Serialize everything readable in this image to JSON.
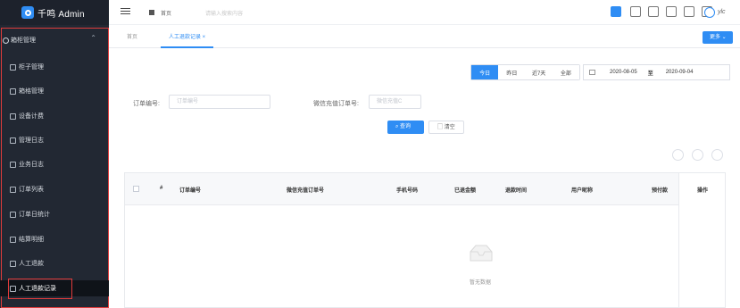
{
  "app": {
    "title": "千鸣 Admin"
  },
  "sidebar": {
    "group": {
      "label": "箱柜管理",
      "icon": "gear-icon"
    },
    "items": [
      {
        "label": "柜子管理",
        "icon": "monitor-icon"
      },
      {
        "label": "箱格管理",
        "icon": "grid-icon"
      },
      {
        "label": "设备计费",
        "icon": "document-icon"
      },
      {
        "label": "管理日志",
        "icon": "document-icon"
      },
      {
        "label": "业务日志",
        "icon": "document-icon"
      },
      {
        "label": "订单列表",
        "icon": "list-icon"
      },
      {
        "label": "订单日统计",
        "icon": "chart-icon"
      },
      {
        "label": "结算明细",
        "icon": "list-icon"
      },
      {
        "label": "人工退款",
        "icon": "image-icon"
      },
      {
        "label": "人工退款记录",
        "icon": "user-icon",
        "active": true
      }
    ]
  },
  "header": {
    "breadcrumb": "首页",
    "search_placeholder": "请输入搜索内容",
    "username": "ylc"
  },
  "tabs": [
    {
      "label": "首页"
    },
    {
      "label": "人工退款记录 ×",
      "active": true
    }
  ],
  "more_label": "更多 ⌄",
  "filters": {
    "order_label": "订单编号:",
    "order_placeholder": "订单编号",
    "wechat_label": "微信充值订单号:",
    "wechat_placeholder": "微信充值C",
    "query_label": "查询",
    "clear_label": "清空"
  },
  "date_buttons": [
    "今日",
    "昨日",
    "近7天",
    "全部"
  ],
  "date_range": {
    "start": "2020-08-05",
    "separator": "至",
    "end": "2020-09-04"
  },
  "table": {
    "columns": [
      "#",
      "订单编号",
      "微信充值订单号",
      "手机号码",
      "已退金额",
      "退款时间",
      "用户昵称",
      "预付款",
      "操作"
    ],
    "empty_text": "暂无数据"
  }
}
